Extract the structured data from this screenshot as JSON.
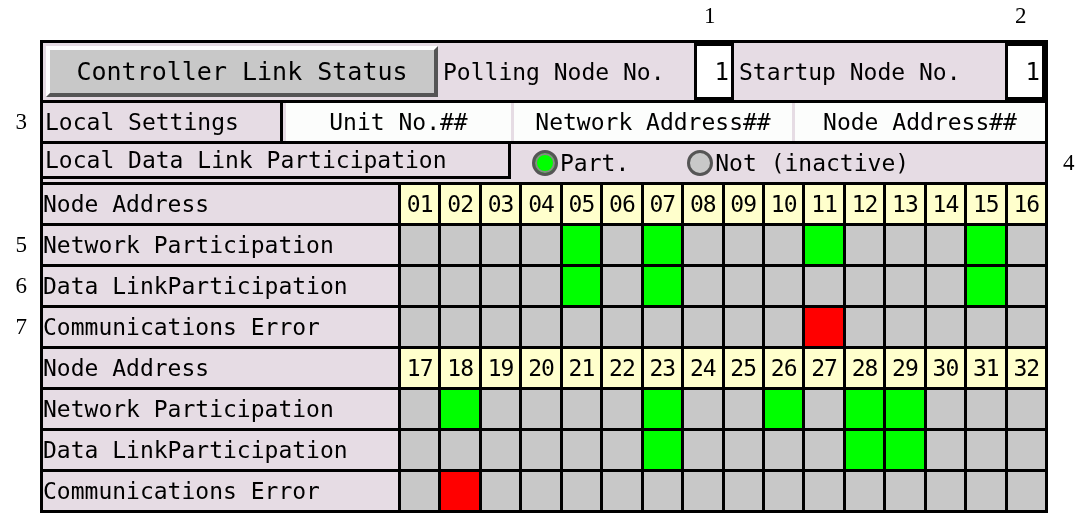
{
  "header": {
    "title_button": "Controller Link Status",
    "fields": [
      {
        "label": "Polling Node No.",
        "value": "1",
        "callout": "1"
      },
      {
        "label": "Startup Node No.",
        "value": "1",
        "callout": "2"
      }
    ]
  },
  "local_settings": {
    "label": "Local Settings",
    "callout": "3",
    "values": [
      "Unit No.##",
      "Network Address##",
      "Node Address##"
    ]
  },
  "local_data_link": {
    "label": "Local Data Link Participation",
    "callout": "4",
    "options": [
      {
        "label": "Part.",
        "selected": true
      },
      {
        "label": "Not (inactive)",
        "selected": false
      }
    ]
  },
  "blocks": [
    {
      "header_label": "Node Address",
      "nodes": [
        "01",
        "02",
        "03",
        "04",
        "05",
        "06",
        "07",
        "08",
        "09",
        "10",
        "11",
        "12",
        "13",
        "14",
        "15",
        "16"
      ],
      "rows": [
        {
          "label": "Network Participation",
          "callout": "5",
          "kind": "participation",
          "cells": [
            false,
            false,
            false,
            false,
            true,
            false,
            true,
            false,
            false,
            false,
            true,
            false,
            false,
            false,
            true,
            false
          ]
        },
        {
          "label": "Data LinkParticipation",
          "callout": "6",
          "kind": "participation",
          "cells": [
            false,
            false,
            false,
            false,
            true,
            false,
            true,
            false,
            false,
            false,
            false,
            false,
            false,
            false,
            true,
            false
          ]
        },
        {
          "label": "Communications Error",
          "callout": "7",
          "kind": "error",
          "cells": [
            false,
            false,
            false,
            false,
            false,
            false,
            false,
            false,
            false,
            false,
            true,
            false,
            false,
            false,
            false,
            false
          ]
        }
      ]
    },
    {
      "header_label": "Node Address",
      "nodes": [
        "17",
        "18",
        "19",
        "20",
        "21",
        "22",
        "23",
        "24",
        "25",
        "26",
        "27",
        "28",
        "29",
        "30",
        "31",
        "32"
      ],
      "rows": [
        {
          "label": "Network Participation",
          "kind": "participation",
          "cells": [
            false,
            true,
            false,
            false,
            false,
            false,
            true,
            false,
            false,
            true,
            false,
            true,
            true,
            false,
            false,
            false
          ]
        },
        {
          "label": "Data LinkParticipation",
          "kind": "participation",
          "cells": [
            false,
            false,
            false,
            false,
            false,
            false,
            true,
            false,
            false,
            false,
            false,
            true,
            true,
            false,
            false,
            false
          ]
        },
        {
          "label": "Communications Error",
          "kind": "error",
          "cells": [
            false,
            true,
            false,
            false,
            false,
            false,
            false,
            false,
            false,
            false,
            false,
            false,
            false,
            false,
            false,
            false
          ]
        }
      ]
    }
  ]
}
